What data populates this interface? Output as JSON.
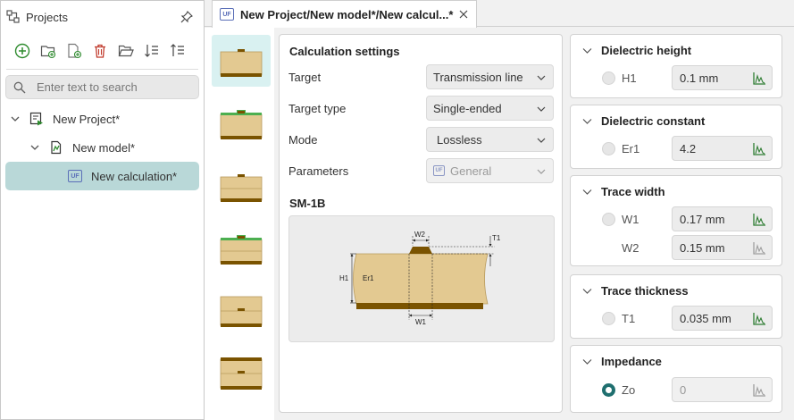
{
  "projects_panel": {
    "title": "Projects",
    "search_placeholder": "Enter text to search",
    "tree": [
      {
        "label": "New Project*"
      },
      {
        "label": "New model*"
      },
      {
        "label": "New calculation*"
      }
    ]
  },
  "tab": {
    "badge": "UF",
    "label": "New Project/New model*/New calcul...*"
  },
  "calc": {
    "title": "Calculation settings",
    "fields": [
      {
        "label": "Target",
        "value": "Transmission line"
      },
      {
        "label": "Target type",
        "value": "Single-ended"
      },
      {
        "label": "Mode",
        "value": "Lossless"
      },
      {
        "label": "Parameters",
        "value": "General",
        "badge": "UF"
      }
    ],
    "diagram_title": "SM-1B",
    "diagram_labels": {
      "w2": "W2",
      "t1": "T1",
      "h1": "H1",
      "er1": "Er1",
      "w1": "W1"
    }
  },
  "params": {
    "dielectric_height": {
      "title": "Dielectric height",
      "rows": [
        {
          "label": "H1",
          "value": "0.1 mm"
        }
      ]
    },
    "dielectric_constant": {
      "title": "Dielectric constant",
      "rows": [
        {
          "label": "Er1",
          "value": "4.2"
        }
      ]
    },
    "trace_width": {
      "title": "Trace width",
      "rows": [
        {
          "label": "W1",
          "value": "0.17 mm"
        },
        {
          "label": "W2",
          "value": "0.15 mm"
        }
      ]
    },
    "trace_thickness": {
      "title": "Trace thickness",
      "rows": [
        {
          "label": "T1",
          "value": "0.035 mm"
        }
      ]
    },
    "impedance": {
      "title": "Impedance",
      "rows": [
        {
          "label": "Zo",
          "value": "0"
        }
      ]
    }
  },
  "colors": {
    "accent": "#1f6f6f",
    "selection": "#b9d8d8",
    "dielectric": "#e3c991",
    "copper": "#7a5300",
    "mask": "#4caf50"
  }
}
